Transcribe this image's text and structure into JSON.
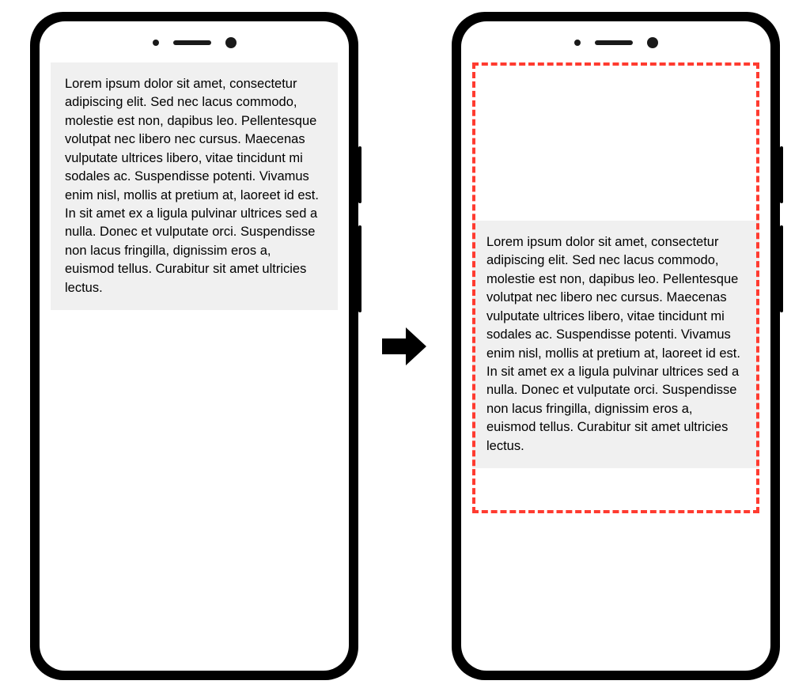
{
  "diagram": {
    "lorem_text": "Lorem ipsum dolor sit amet, consectetur adipiscing elit. Sed nec lacus commodo, molestie est non, dapibus leo. Pellentesque volutpat nec libero nec cursus. Maecenas vulputate ultrices libero, vitae tincidunt mi sodales ac. Suspendisse potenti. Vivamus enim nisl, mollis at pretium at, laoreet id est. In sit amet ex a ligula pulvinar ultrices sed a nulla. Donec et vulputate orci. Suspendisse non lacus fringilla, dignissim eros a, euismod tellus. Curabitur sit amet ultricies lectus."
  },
  "colors": {
    "dashed_border": "#ff3b30",
    "text_box_bg": "#f0f0f0",
    "phone_frame": "#000000"
  }
}
